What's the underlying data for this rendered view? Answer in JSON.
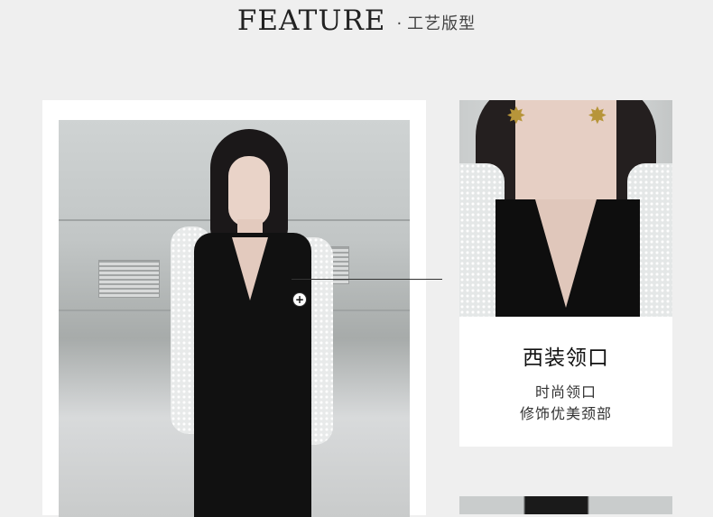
{
  "header": {
    "title": "FEATURE",
    "separator": "·",
    "subtitle": "工艺版型"
  },
  "feature": {
    "title": "西装领口",
    "desc_line1": "时尚领口",
    "desc_line2": "修饰优美颈部",
    "hotspot_symbol": "+"
  },
  "colors": {
    "background": "#efefef",
    "card": "#ffffff",
    "text_dark": "#111111",
    "earring_gold": "#b7953a"
  },
  "icons": {
    "hotspot": "plus-circle-icon",
    "earring": "star-earring-icon"
  }
}
